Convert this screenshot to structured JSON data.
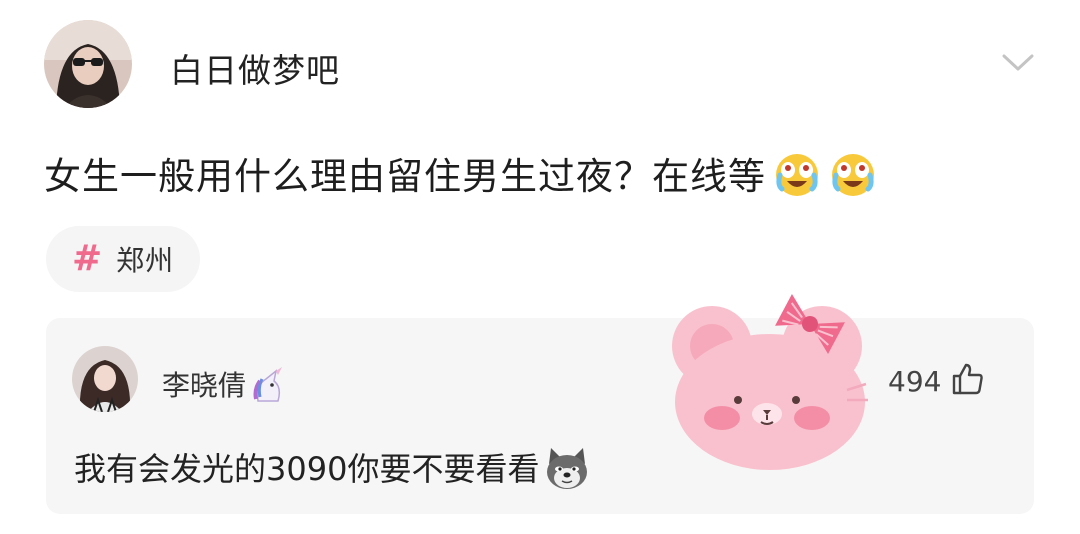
{
  "post": {
    "username": "白日做梦吧",
    "text": "女生一般用什么理由留住男生过夜？在线等",
    "emojis": [
      "crying-laughing-emoji",
      "crying-laughing-emoji"
    ],
    "location_tag": {
      "icon": "hash-icon",
      "label": "郑州"
    }
  },
  "comment": {
    "username": "李晓倩",
    "badge_icon": "unicorn-icon",
    "like_count": "494",
    "like_icon": "thumbs-up-icon",
    "text": "我有会发光的3090你要不要看看",
    "emoji": "doge-emoji"
  },
  "colors": {
    "hash": "#f06a8e",
    "card_bg": "#f6f6f6",
    "tag_bg": "#f5f5f5",
    "sticker": "#f9c1ce"
  }
}
